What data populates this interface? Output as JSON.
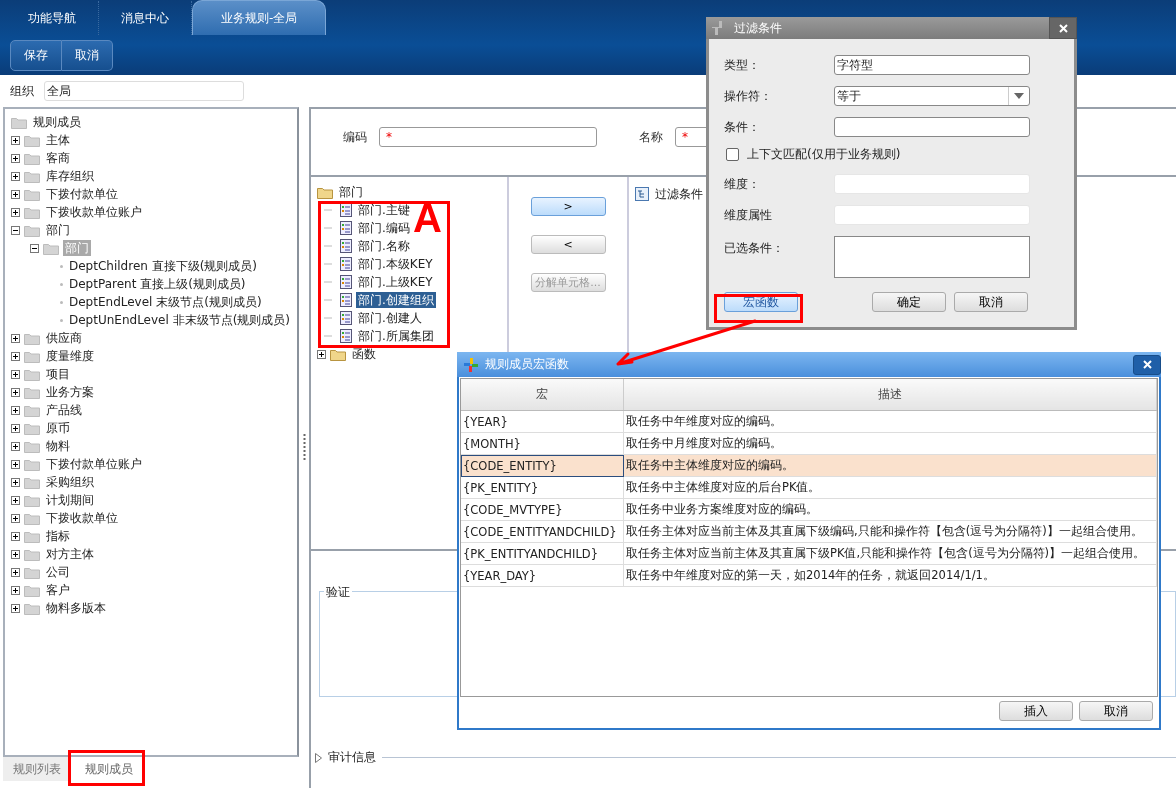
{
  "tabs": [
    {
      "label": "功能导航",
      "selected": false
    },
    {
      "label": "消息中心",
      "selected": false
    },
    {
      "label": "业务规则-全局",
      "selected": true
    }
  ],
  "toolbar": [
    "保存",
    "取消"
  ],
  "org": {
    "label": "组织",
    "value": "全局"
  },
  "member_tree": {
    "root": "规则成员",
    "children": [
      {
        "kind": "folder",
        "label": "主体",
        "expanded": false,
        "selected": false
      },
      {
        "kind": "folder",
        "label": "客商",
        "expanded": false,
        "selected": false
      },
      {
        "kind": "folder",
        "label": "库存组织",
        "expanded": false,
        "selected": false
      },
      {
        "kind": "folder",
        "label": "下拨付款单位",
        "expanded": false,
        "selected": false
      },
      {
        "kind": "folder",
        "label": "下拨收款单位账户",
        "expanded": false,
        "selected": false
      },
      {
        "kind": "folder",
        "label": "部门",
        "expanded": true,
        "selected": false,
        "children": [
          {
            "kind": "folder",
            "label": "部门",
            "expanded": true,
            "selected": true,
            "children": [
              {
                "kind": "leaf",
                "label": "DeptChildren 直接下级(规则成员)",
                "selected": false
              },
              {
                "kind": "leaf",
                "label": "DeptParent 直接上级(规则成员)",
                "selected": false
              },
              {
                "kind": "leaf",
                "label": "DeptEndLevel 末级节点(规则成员)",
                "selected": false
              },
              {
                "kind": "leaf",
                "label": "DeptUnEndLevel 非末级节点(规则成员)",
                "selected": false
              }
            ]
          }
        ]
      },
      {
        "kind": "folder",
        "label": "供应商",
        "expanded": false,
        "selected": false
      },
      {
        "kind": "folder",
        "label": "度量维度",
        "expanded": false,
        "selected": false
      },
      {
        "kind": "folder",
        "label": "项目",
        "expanded": false,
        "selected": false
      },
      {
        "kind": "folder",
        "label": "业务方案",
        "expanded": false,
        "selected": false
      },
      {
        "kind": "folder",
        "label": "产品线",
        "expanded": false,
        "selected": false
      },
      {
        "kind": "folder",
        "label": "原币",
        "expanded": false,
        "selected": false
      },
      {
        "kind": "folder",
        "label": "物料",
        "expanded": false,
        "selected": false
      },
      {
        "kind": "folder",
        "label": "下拨付款单位账户",
        "expanded": false,
        "selected": false
      },
      {
        "kind": "folder",
        "label": "采购组织",
        "expanded": false,
        "selected": false
      },
      {
        "kind": "folder",
        "label": "计划期间",
        "expanded": false,
        "selected": false
      },
      {
        "kind": "folder",
        "label": "下拨收款单位",
        "expanded": false,
        "selected": false
      },
      {
        "kind": "folder",
        "label": "指标",
        "expanded": false,
        "selected": false
      },
      {
        "kind": "folder",
        "label": "对方主体",
        "expanded": false,
        "selected": false
      },
      {
        "kind": "folder",
        "label": "公司",
        "expanded": false,
        "selected": false
      },
      {
        "kind": "folder",
        "label": "客户",
        "expanded": false,
        "selected": false
      },
      {
        "kind": "folder",
        "label": "物料多版本",
        "expanded": false,
        "selected": false
      }
    ]
  },
  "bottom_tabs": [
    {
      "label": "规则列表",
      "selected": false
    },
    {
      "label": "规则成员",
      "selected": true
    }
  ],
  "form": [
    {
      "label": "编码",
      "mark": "*"
    },
    {
      "label": "名称",
      "mark": "*"
    }
  ],
  "field_tree": {
    "root": "部门",
    "items": [
      {
        "label": "部门.主键",
        "selected": false
      },
      {
        "label": "部门.编码",
        "selected": false
      },
      {
        "label": "部门.名称",
        "selected": false
      },
      {
        "label": "部门.本级KEY",
        "selected": false
      },
      {
        "label": "部门.上级KEY",
        "selected": false
      },
      {
        "label": "部门.创建组织",
        "selected": true
      },
      {
        "label": "部门.创建人",
        "selected": false
      },
      {
        "label": "部门.所属集团",
        "selected": false
      }
    ],
    "functions": {
      "label": "函数",
      "expanded": false
    }
  },
  "move_buttons": [
    {
      "label": ">",
      "highlighted": true,
      "disabled": false
    },
    {
      "label": "<",
      "highlighted": false,
      "disabled": false
    },
    {
      "label": "分解单元格...",
      "highlighted": false,
      "disabled": true
    }
  ],
  "condition_tree": {
    "root": "过滤条件"
  },
  "validate_section": {
    "label": "验证"
  },
  "audit_section": {
    "label": "审计信息",
    "expanded": false
  },
  "filter_dialog": {
    "title": "过滤条件",
    "fields": [
      {
        "kind": "text",
        "label": "类型：",
        "value": "字符型",
        "disabled": false
      },
      {
        "kind": "select",
        "label": "操作符：",
        "value": "等于",
        "disabled": false
      },
      {
        "kind": "text",
        "label": "条件：",
        "disabled": false
      },
      {
        "kind": "checkbox",
        "label": "上下文匹配(仅用于业务规则)",
        "checked": false
      },
      {
        "kind": "text",
        "label": "维度：",
        "disabled": true
      },
      {
        "kind": "text",
        "label": "维度属性",
        "disabled": true
      },
      {
        "kind": "textarea",
        "label": "已选条件："
      }
    ],
    "buttons": [
      {
        "label": "宏函数",
        "highlighted": true
      },
      {
        "label": "确定",
        "highlighted": false
      },
      {
        "label": "取消",
        "highlighted": false
      }
    ]
  },
  "macro_dialog": {
    "title": "规则成员宏函数",
    "columns": [
      "宏",
      "描述"
    ],
    "rows": [
      {
        "macro": "{YEAR}",
        "description": "取任务中年维度对应的编码。",
        "selected": false
      },
      {
        "macro": "{MONTH}",
        "description": "取任务中月维度对应的编码。",
        "selected": false
      },
      {
        "macro": "{CODE_ENTITY}",
        "description": "取任务中主体维度对应的编码。",
        "selected": true
      },
      {
        "macro": "{PK_ENTITY}",
        "description": "取任务中主体维度对应的后台PK值。",
        "selected": false
      },
      {
        "macro": "{CODE_MVTYPE}",
        "description": "取任务中业务方案维度对应的编码。",
        "selected": false
      },
      {
        "macro": "{CODE_ENTITYANDCHILD}",
        "description": "取任务主体对应当前主体及其直属下级编码,只能和操作符【包含(逗号为分隔符)】一起组合使用。",
        "selected": false
      },
      {
        "macro": "{PK_ENTITYANDCHILD}",
        "description": "取任务主体对应当前主体及其直属下级PK值,只能和操作符【包含(逗号为分隔符)】一起组合使用。",
        "selected": false
      },
      {
        "macro": "{YEAR_DAY}",
        "description": "取任务中年维度对应的第一天，如2014年的任务，就返回2014/1/1。",
        "selected": false
      }
    ],
    "buttons": [
      "插入",
      "取消"
    ]
  },
  "annotation": {
    "label": "A"
  }
}
